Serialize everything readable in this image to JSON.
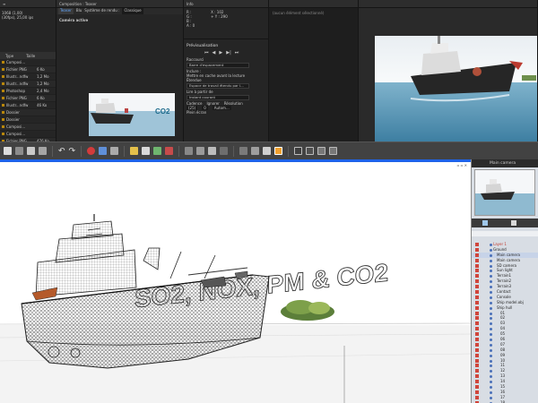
{
  "project_panel": {
    "meta_lines": [
      "1068 (1,00)",
      "(30fps), 25,00 ips"
    ],
    "col_type": "Type",
    "col_taille": "Taille",
    "items": [
      {
        "name": "Composi...",
        "type": "",
        "size": ""
      },
      {
        "name": "Fichier PNG",
        "type": "",
        "size": "6 Ko"
      },
      {
        "name": "Illustr...ndfw",
        "type": "",
        "size": "1,2 Mo"
      },
      {
        "name": "Illustr...ndfw",
        "type": "",
        "size": "1,2 Mo"
      },
      {
        "name": "Photoshop",
        "type": "",
        "size": "2,4 Mo"
      },
      {
        "name": "Fichier PNG",
        "type": "",
        "size": "6 Ko"
      },
      {
        "name": "Illustr...ndfw",
        "type": "",
        "size": "46 Ko"
      },
      {
        "name": "Dossier",
        "type": "",
        "size": ""
      },
      {
        "name": "Dossier",
        "type": "",
        "size": ""
      },
      {
        "name": "Composi...",
        "type": "",
        "size": ""
      },
      {
        "name": "Composi...",
        "type": "",
        "size": ""
      },
      {
        "name": "Fichier PNG",
        "type": "",
        "size": "476 Ko"
      },
      {
        "name": "Dossier",
        "type": "",
        "size": ""
      },
      {
        "name": "Dossier",
        "type": "",
        "size": ""
      }
    ]
  },
  "composition_panel": {
    "title": "Composition : Teaser",
    "tab_active": "Teaser",
    "tab_other": "Blu",
    "sys_label": "Système de rendu :",
    "sys_value": "Classique",
    "camera_label": "Caméra active"
  },
  "info_panel": {
    "title": "Info",
    "r": "R :",
    "g": "G :",
    "b": "B :",
    "a": "A : 0",
    "x": "X : 102",
    "y": "+ Y : 290",
    "preview_title": "Prévisualisation",
    "shortcut_label": "Raccourci",
    "shortcut_value": "Barre d'espacement",
    "include_label": "Inclure :",
    "cache_label": "Mettre en cache avant la lecture",
    "range_label": "Étendue",
    "range_value": "Espace de travail étendu par l...",
    "play_label": "Lire à partir de",
    "play_value": "Instant courant",
    "cadence_label": "Cadence",
    "skip_label": "Ignorer",
    "resolution_label": "Résolution",
    "cadence_value": "(25)",
    "skip_value": "0",
    "resolution_value": "Autom...",
    "fullscreen_label": "Plein écran"
  },
  "empty_panel": {
    "text": "(aucun élément sélectionné)"
  },
  "viewport": {
    "scene_text": "SO2, NOX, PM & CO2",
    "thumb_text": "CO2"
  },
  "side_panel": {
    "title": "Main camera",
    "tree": [
      "Layer 1",
      "Ground",
      "Main camera",
      "Main camera",
      "SD camera",
      "Sun light",
      "Terrain1",
      "Terrain2",
      "Terrain3",
      "Contact",
      "Console",
      "Ship model.obj",
      "Ship hull",
      "01",
      "02",
      "03",
      "04",
      "05",
      "06",
      "07",
      "08",
      "09",
      "10",
      "11",
      "12",
      "13",
      "14",
      "15",
      "16",
      "17",
      "18",
      "19"
    ]
  },
  "colors": {
    "accent_blue": "#1e63e9",
    "tab_blue": "#62a8ff",
    "wire": "#3a3a3a"
  }
}
